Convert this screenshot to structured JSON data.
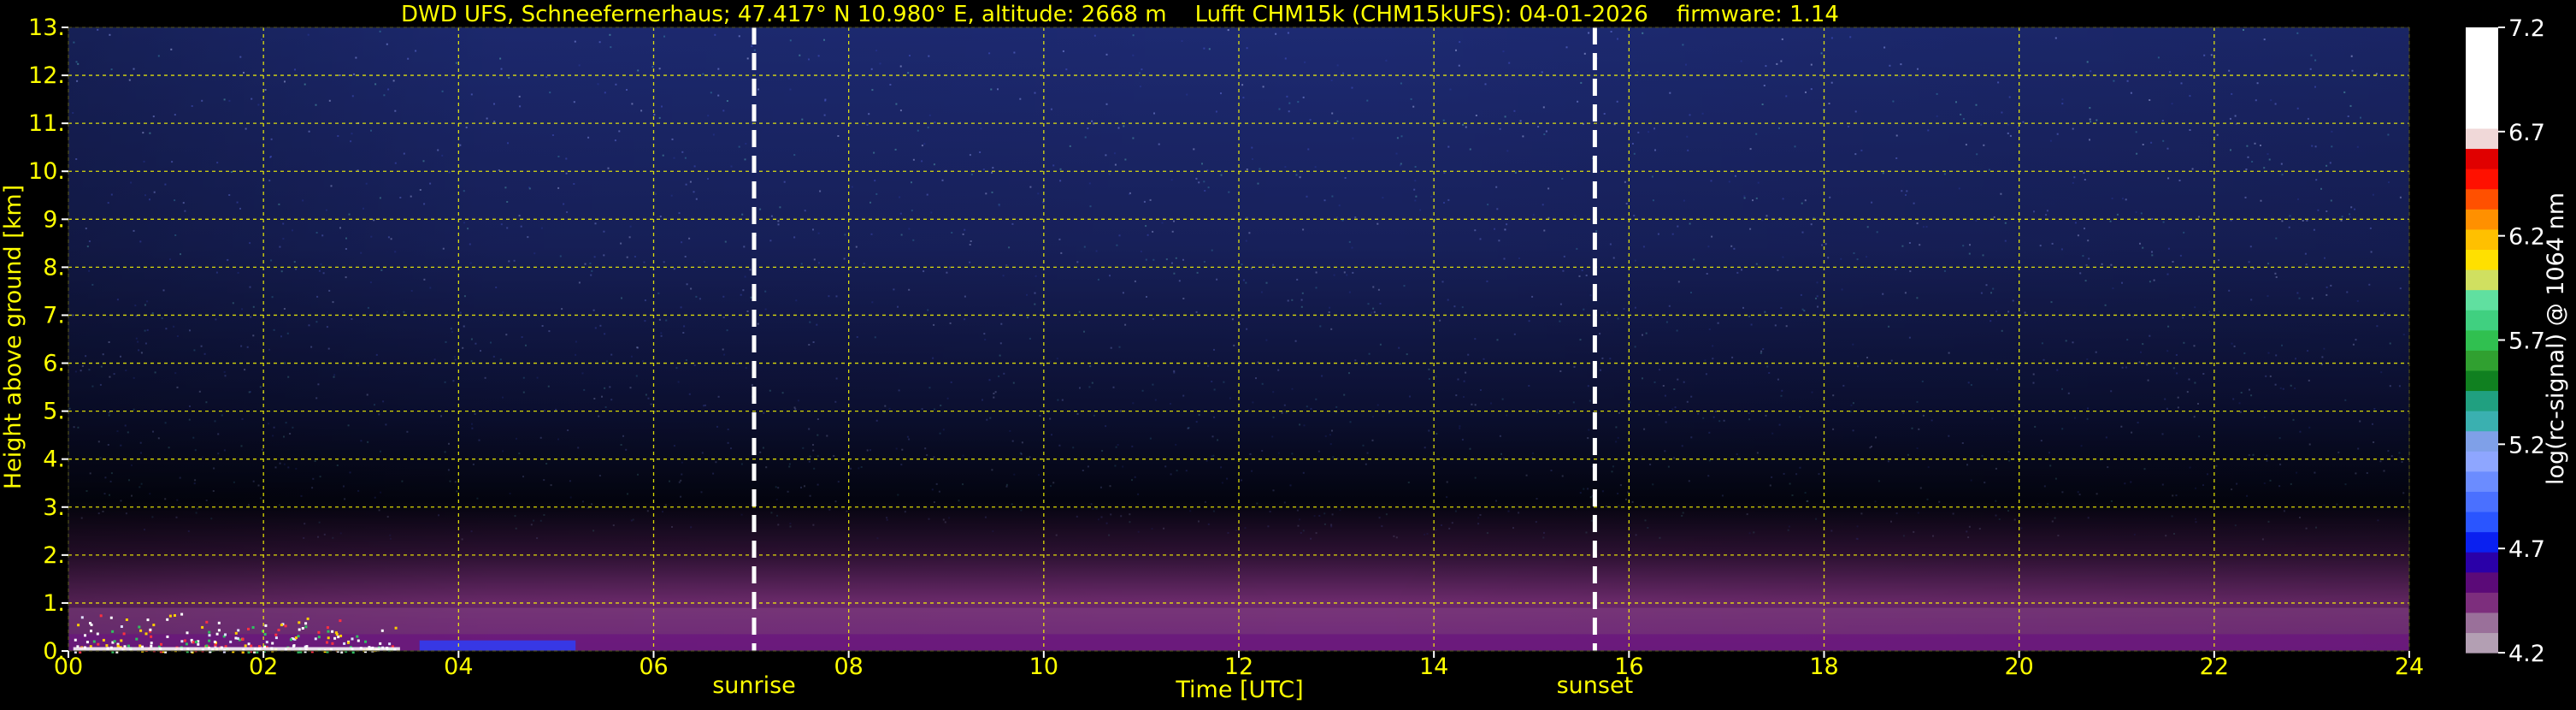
{
  "chart_data": {
    "type": "heatmap",
    "title": "DWD UFS, Schneefernerhaus; 47.417° N 10.980° E, altitude: 2668 m    Lufft CHM15k (CHM15kUFS): 04-01-2026    firmware: 1.14",
    "xlabel": "Time [UTC]",
    "ylabel": "Height above ground [km]",
    "xlim": [
      0,
      24
    ],
    "ylim": [
      0,
      13
    ],
    "x_ticks": [
      0,
      2,
      4,
      6,
      8,
      10,
      12,
      14,
      16,
      18,
      20,
      22,
      24
    ],
    "x_tick_labels": [
      "00",
      "02",
      "04",
      "06",
      "08",
      "10",
      "12",
      "14",
      "16",
      "18",
      "20",
      "22",
      "24"
    ],
    "y_ticks": [
      0,
      1,
      2,
      3,
      4,
      5,
      6,
      7,
      8,
      9,
      10,
      11,
      12,
      13
    ],
    "y_tick_labels": [
      "0.",
      "1.",
      "2.",
      "3.",
      "4.",
      "5.",
      "6.",
      "7.",
      "8.",
      "9.",
      "10.",
      "11.",
      "12.",
      "13."
    ],
    "grid": true,
    "grid_color": "#ffff00",
    "annotations": [
      {
        "label": "sunrise",
        "time": 7.03
      },
      {
        "label": "sunset",
        "time": 15.65
      }
    ],
    "colorbar": {
      "label": "log(rc-signal) @ 1064 nm",
      "min": 4.2,
      "max": 7.2,
      "tick_values": [
        4.2,
        4.7,
        5.2,
        5.7,
        6.2,
        6.7,
        7.2
      ],
      "tick_labels": [
        "4.2",
        "4.7",
        "5.2",
        "5.7",
        "6.2",
        "6.7",
        "7.2"
      ],
      "colors": [
        "#b39fb3",
        "#9a709a",
        "#7d2e7d",
        "#5b0a78",
        "#2a00a8",
        "#0a20f0",
        "#2a55ff",
        "#4a70ff",
        "#6b8cff",
        "#8ea6ff",
        "#7fa0e8",
        "#3ab0b0",
        "#20a080",
        "#108020",
        "#30a030",
        "#30c050",
        "#40d080",
        "#60e0a0",
        "#d0e060",
        "#ffe000",
        "#ffc000",
        "#ff9000",
        "#ff5000",
        "#ff1000",
        "#e00000",
        "#f0d8d8",
        "#ffffff",
        "#ffffff",
        "#ffffff",
        "#ffffff",
        "#ffffff"
      ]
    },
    "background_color": "#000000",
    "text_color": "#ffff00"
  }
}
